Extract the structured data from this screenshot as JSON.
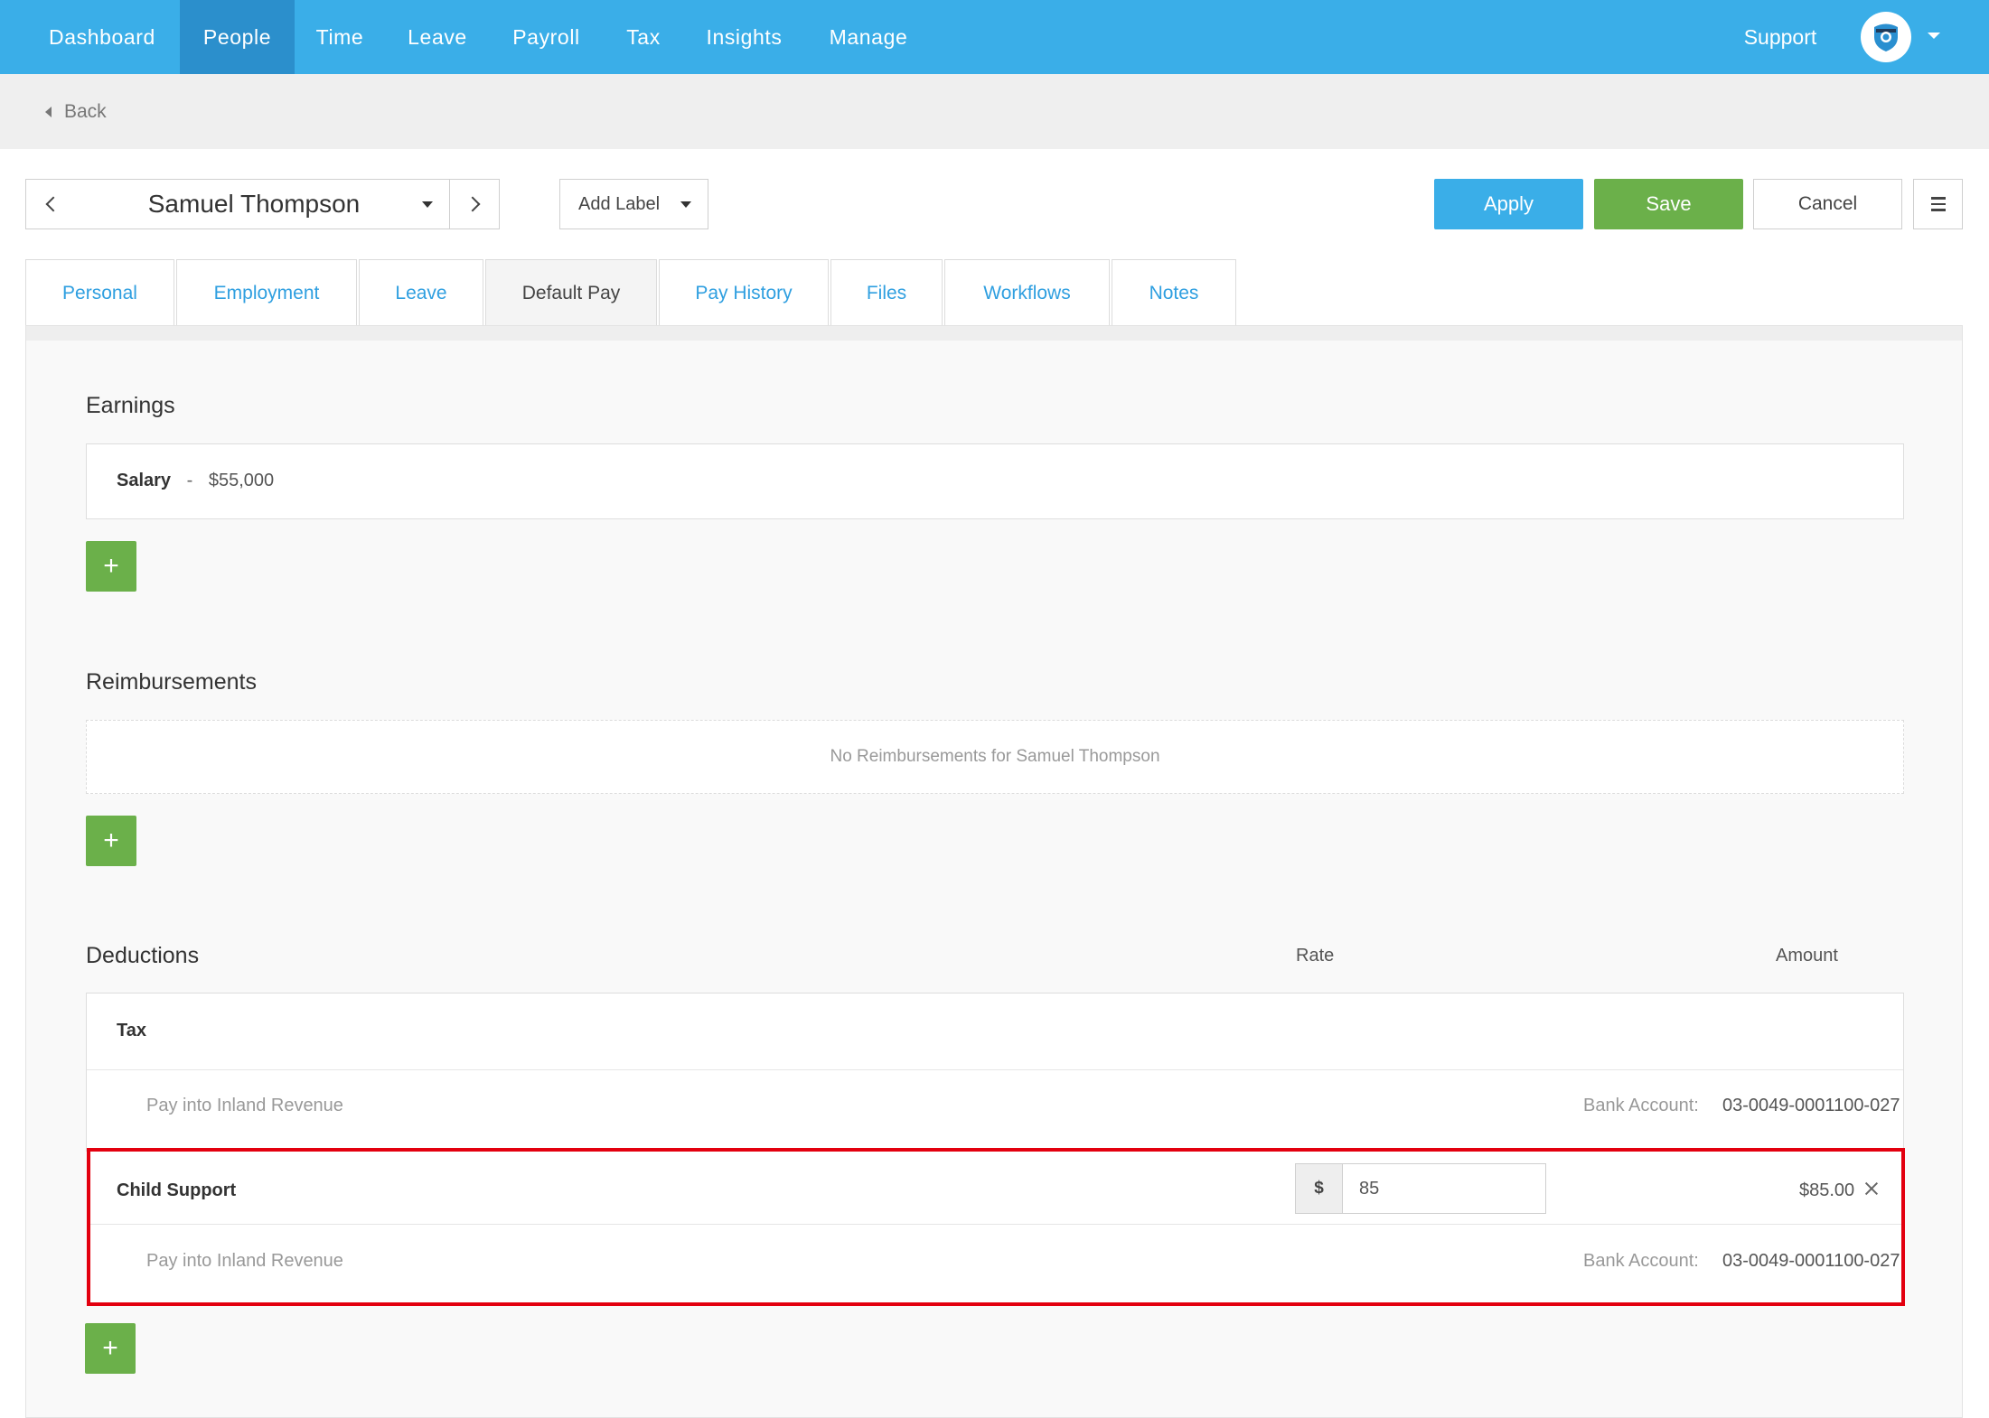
{
  "nav": {
    "items": [
      {
        "label": "Dashboard",
        "active": false
      },
      {
        "label": "People",
        "active": true
      },
      {
        "label": "Time",
        "active": false
      },
      {
        "label": "Leave",
        "active": false
      },
      {
        "label": "Payroll",
        "active": false
      },
      {
        "label": "Tax",
        "active": false
      },
      {
        "label": "Insights",
        "active": false
      },
      {
        "label": "Manage",
        "active": false
      }
    ],
    "support_label": "Support",
    "accent_color": "#3aaee8",
    "active_color": "#2b8fcc"
  },
  "back": {
    "label": "Back"
  },
  "toolbar": {
    "employee_name": "Samuel Thompson",
    "add_label": "Add Label",
    "apply_label": "Apply",
    "save_label": "Save",
    "cancel_label": "Cancel",
    "menu_icon": "hamburger-icon"
  },
  "tabs": [
    {
      "label": "Personal",
      "active": false
    },
    {
      "label": "Employment",
      "active": false
    },
    {
      "label": "Leave",
      "active": false
    },
    {
      "label": "Default Pay",
      "active": true
    },
    {
      "label": "Pay History",
      "active": false
    },
    {
      "label": "Files",
      "active": false
    },
    {
      "label": "Workflows",
      "active": false
    },
    {
      "label": "Notes",
      "active": false
    }
  ],
  "earnings": {
    "title": "Earnings",
    "items": [
      {
        "name": "Salary",
        "separator": "-",
        "amount": "$55,000"
      }
    ],
    "add_label": "+"
  },
  "reimbursements": {
    "title": "Reimbursements",
    "empty_message": "No Reimbursements for Samuel Thompson",
    "add_label": "+"
  },
  "deductions": {
    "title": "Deductions",
    "rate_header": "Rate",
    "amount_header": "Amount",
    "items": [
      {
        "name": "Tax",
        "pay_into": "Pay into Inland Revenue",
        "bank_label": "Bank Account:",
        "bank_account": "03-0049-0001100-027"
      },
      {
        "name": "Child Support",
        "rate_prefix": "$",
        "rate_value": "85",
        "amount": "$85.00",
        "pay_into": "Pay into Inland Revenue",
        "bank_label": "Bank Account:",
        "bank_account": "03-0049-0001100-027",
        "highlighted": true
      }
    ],
    "add_label": "+"
  },
  "colors": {
    "green": "#6bb04a",
    "highlight": "#e3000f",
    "link": "#2f9fe0"
  }
}
